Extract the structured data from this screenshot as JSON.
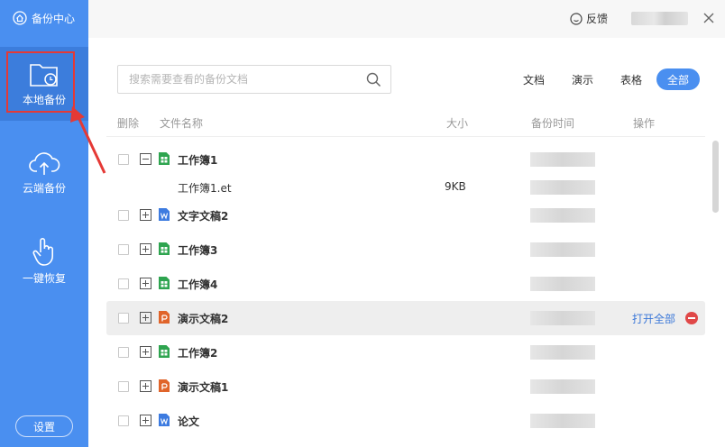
{
  "app": {
    "title": "备份中心"
  },
  "sidebar": {
    "items": [
      {
        "label": "本地备份",
        "icon": "folder-clock-icon",
        "active": true
      },
      {
        "label": "云端备份",
        "icon": "cloud-upload-icon",
        "active": false
      },
      {
        "label": "一键恢复",
        "icon": "hand-pointer-icon",
        "active": false
      }
    ],
    "settings_label": "设置"
  },
  "header": {
    "feedback_label": "反馈"
  },
  "search": {
    "placeholder": "搜索需要查看的备份文档"
  },
  "filters": [
    {
      "label": "文档",
      "active": false
    },
    {
      "label": "演示",
      "active": false
    },
    {
      "label": "表格",
      "active": false
    },
    {
      "label": "全部",
      "active": true
    }
  ],
  "table": {
    "columns": {
      "delete": "删除",
      "name": "文件名称",
      "size": "大小",
      "time": "备份时间",
      "action": "操作"
    },
    "rows": [
      {
        "name": "工作簿1",
        "type": "sheet",
        "expanded": true
      },
      {
        "child": true,
        "name": "工作簿1.et",
        "size": "9KB"
      },
      {
        "name": "文字文稿2",
        "type": "doc"
      },
      {
        "name": "工作簿3",
        "type": "sheet"
      },
      {
        "name": "工作簿4",
        "type": "sheet"
      },
      {
        "name": "演示文稿2",
        "type": "ppt",
        "hover": true,
        "action": "打开全部"
      },
      {
        "name": "工作簿2",
        "type": "sheet"
      },
      {
        "name": "演示文稿1",
        "type": "ppt"
      },
      {
        "name": "论文",
        "type": "doc"
      }
    ]
  },
  "colors": {
    "sidebar": "#4a8ff0",
    "accent": "#4a8ff0",
    "sheet": "#2ea44f",
    "doc": "#3d7be0",
    "ppt": "#e0642a",
    "highlight": "#e53935"
  }
}
